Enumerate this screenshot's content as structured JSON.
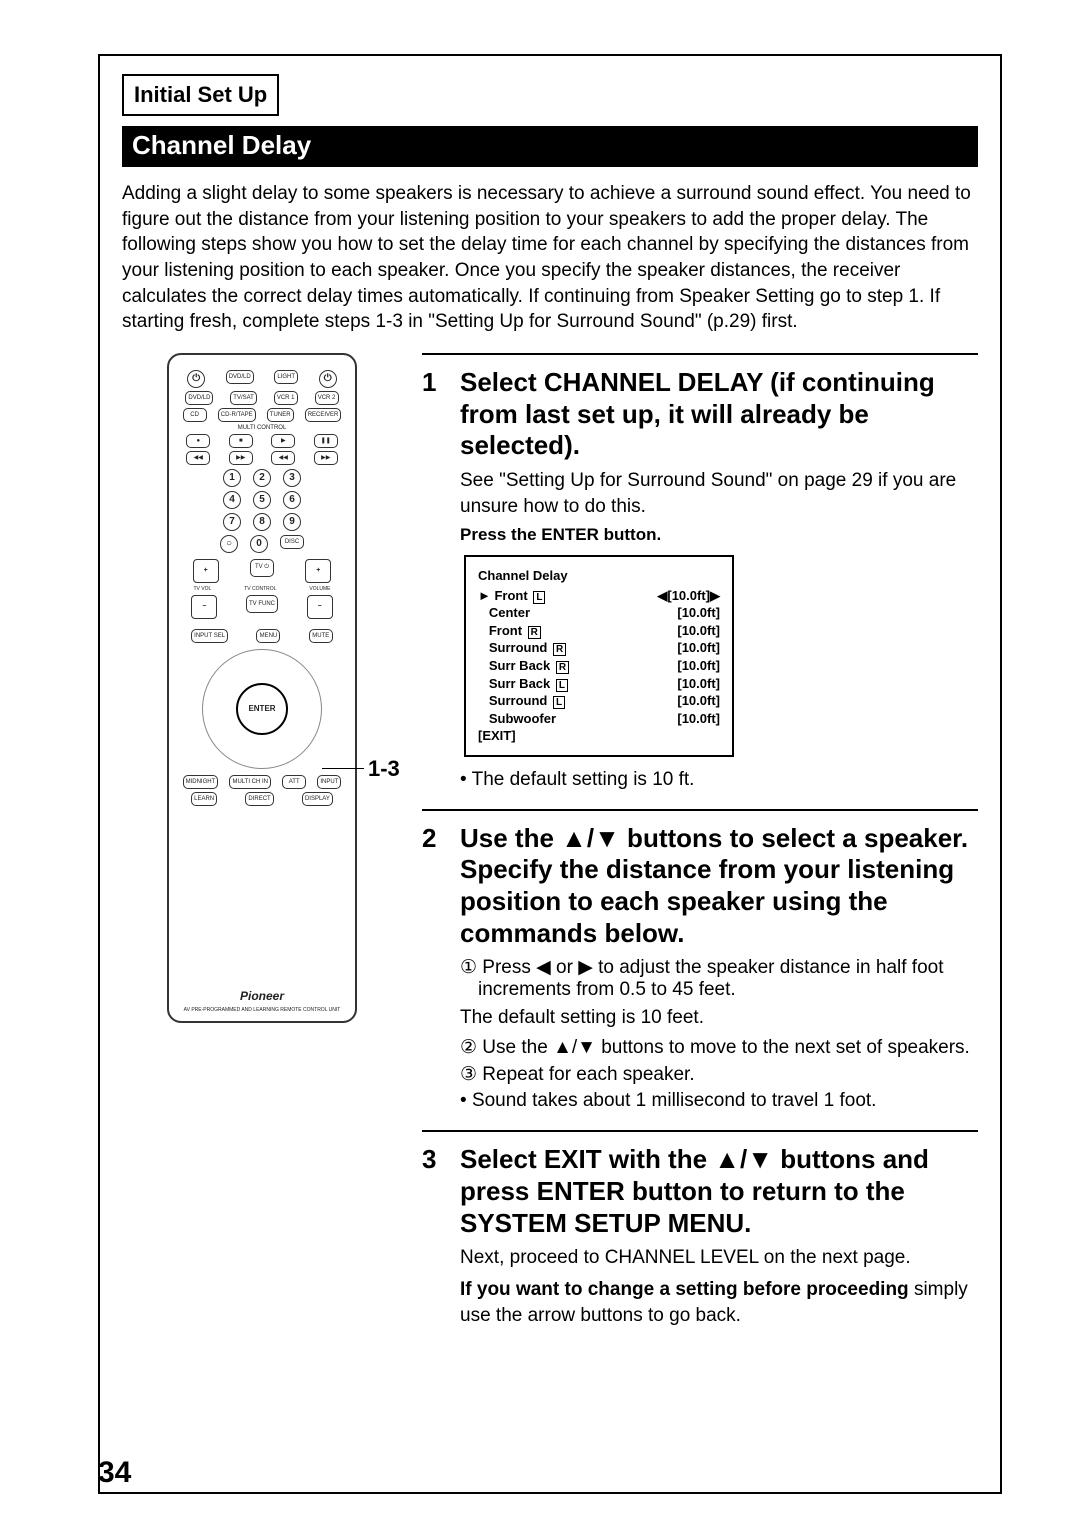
{
  "header_tab": "Initial Set Up",
  "section_title": "Channel Delay",
  "intro": "Adding a slight delay to some speakers is necessary to achieve a surround sound effect. You need to figure out the distance from your listening position to your speakers to add the proper delay. The following steps show you how to set the delay time for each channel by specifying the distances from your listening position to each speaker. Once you specify the speaker distances, the receiver calculates the correct delay times automatically. If continuing from Speaker Setting go to step 1. If starting fresh, complete steps 1-3 in \"Setting Up for Surround Sound\" (p.29) first.",
  "callout": "1-3",
  "remote": {
    "brand": "Pioneer",
    "sub": "AV PRE-PROGRAMMED AND LEARNING REMOTE CONTROL UNIT",
    "enter": "ENTER",
    "row_labels": [
      "DVD/LD",
      "TV/SAT",
      "VCR 1",
      "VCR 2"
    ],
    "row_labels2": [
      "CD",
      "CD-R/TAPE",
      "TUNER",
      "RECEIVER"
    ],
    "nums": [
      "1",
      "2",
      "3",
      "4",
      "5",
      "6",
      "7",
      "8",
      "9",
      "0"
    ]
  },
  "steps": [
    {
      "n": "1",
      "h": "Select CHANNEL DELAY (if continuing from last set up, it will already be selected).",
      "p1": "See \"Setting Up for Surround Sound\" on page 29 if you are unsure how to do this.",
      "b": "Press the ENTER button.",
      "lcd": {
        "title": "Channel Delay",
        "rows": [
          {
            "label": "► Front",
            "ch": "L",
            "val": "◀[10.0ft]▶"
          },
          {
            "label": "   Center",
            "ch": "",
            "val": "[10.0ft]"
          },
          {
            "label": "   Front",
            "ch": "R",
            "val": "[10.0ft]"
          },
          {
            "label": "   Surround",
            "ch": "R",
            "val": "[10.0ft]"
          },
          {
            "label": "   Surr Back",
            "ch": "R",
            "val": "[10.0ft]"
          },
          {
            "label": "   Surr Back",
            "ch": "L",
            "val": "[10.0ft]"
          },
          {
            "label": "   Surround",
            "ch": "L",
            "val": "[10.0ft]"
          },
          {
            "label": "   Subwoofer",
            "ch": "",
            "val": "[10.0ft]"
          }
        ],
        "exit": "[EXIT]"
      },
      "bul": "The default setting is 10 ft."
    },
    {
      "n": "2",
      "h": "Use the ▲/▼ buttons to select a speaker. Specify the distance from your listening position to each speaker using the commands below.",
      "e1": "① Press ◀ or ▶ to adjust the speaker distance in half foot increments from 0.5 to 45 feet.",
      "p1": "The default setting is 10 feet.",
      "e2": "② Use the ▲/▼ buttons to move to the next set of speakers.",
      "e3": "③ Repeat for each speaker.",
      "bul": "Sound takes about 1 millisecond to travel 1 foot."
    },
    {
      "n": "3",
      "h": "Select EXIT with the ▲/▼ buttons and press ENTER button  to return to the SYSTEM SETUP MENU.",
      "p1": "Next, proceed to CHANNEL LEVEL on the next page.",
      "b2a": "If you want to change a setting before proceeding",
      "b2b": " simply use the arrow buttons to go back."
    }
  ],
  "page_number": "34"
}
